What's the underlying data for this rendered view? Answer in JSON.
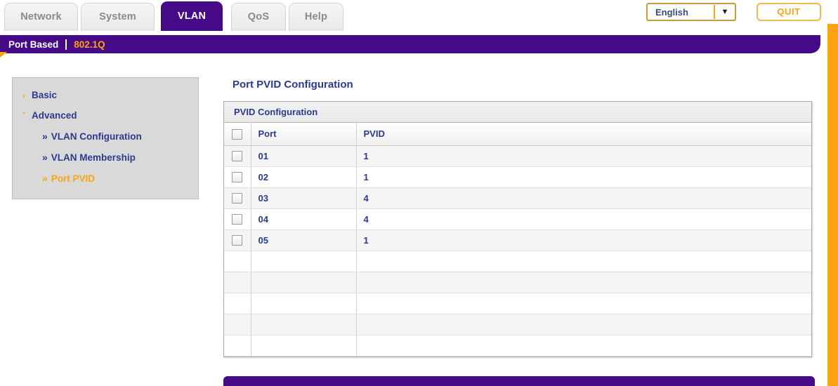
{
  "header": {
    "tabs": [
      {
        "label": "Network",
        "active": false
      },
      {
        "label": "System",
        "active": false
      },
      {
        "label": "VLAN",
        "active": true
      },
      {
        "label": "QoS",
        "active": false
      },
      {
        "label": "Help",
        "active": false
      }
    ],
    "language": {
      "value": "English",
      "caret_icon": "chevron-down-icon"
    },
    "quit_label": "QUIT"
  },
  "subnav": {
    "items": [
      {
        "label": "Port Based",
        "active": false
      },
      {
        "label": "802.1Q",
        "active": true
      }
    ]
  },
  "sidebar": {
    "items": [
      {
        "label": "Basic",
        "marker": "›",
        "level": 0,
        "active": false
      },
      {
        "label": "Advanced",
        "marker": "ˇ",
        "level": 0,
        "active": false
      },
      {
        "label": "VLAN Configuration",
        "marker": "»",
        "level": 1,
        "active": false
      },
      {
        "label": "VLAN Membership",
        "marker": "»",
        "level": 1,
        "active": false
      },
      {
        "label": "Port PVID",
        "marker": "»",
        "level": 1,
        "active": true
      }
    ]
  },
  "main": {
    "page_title": "Port PVID Configuration",
    "panel_title": "PVID Configuration",
    "table": {
      "columns": [
        "",
        "Port",
        "PVID"
      ],
      "rows": [
        {
          "port": "01",
          "pvid": "1"
        },
        {
          "port": "02",
          "pvid": "1"
        },
        {
          "port": "03",
          "pvid": "4"
        },
        {
          "port": "04",
          "pvid": "4"
        },
        {
          "port": "05",
          "pvid": "1"
        }
      ],
      "empty_rows": 5
    }
  },
  "colors": {
    "purple": "#470A87",
    "orange": "#FCA311",
    "nav_blue": "#2B3990",
    "sidebar_gray": "#D9D9D9"
  }
}
